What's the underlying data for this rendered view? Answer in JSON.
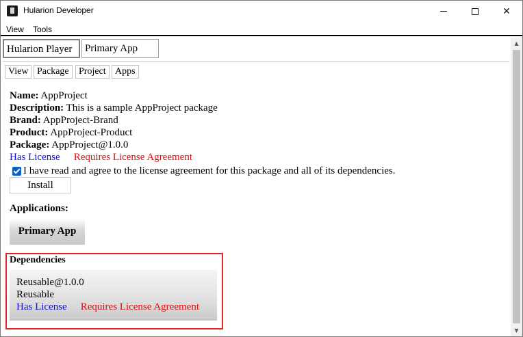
{
  "window": {
    "title": "Hularion Developer",
    "controls": {
      "minimize": "—",
      "maximize": "☐",
      "close": "✕"
    }
  },
  "menu": {
    "view": "View",
    "tools": "Tools"
  },
  "top_tabs": {
    "player": "Hularion Player",
    "primary": "Primary App"
  },
  "sub_tabs": {
    "view": "View",
    "package": "Package",
    "project": "Project",
    "apps": "Apps"
  },
  "package": {
    "name_label": "Name:",
    "name": "AppProject",
    "description_label": "Description:",
    "description": "This is a sample AppProject package",
    "brand_label": "Brand:",
    "brand": "AppProject-Brand",
    "product_label": "Product:",
    "product": "AppProject-Product",
    "package_label": "Package:",
    "package": "AppProject@1.0.0",
    "has_license": "Has License",
    "requires_license": "Requires License Agreement",
    "agree_checked": true,
    "agree_text": "I have read and agree to the license agreement for this package and all of its dependencies.",
    "install_label": "Install"
  },
  "applications": {
    "title": "Applications:",
    "primary_app_label": "Primary App"
  },
  "dependencies": {
    "title": "Dependencies",
    "items": [
      {
        "package": "Reusable@1.0.0",
        "name": "Reusable",
        "has_license": "Has License",
        "requires_license": "Requires License Agreement"
      }
    ]
  },
  "colors": {
    "license_blue": "#1414d2",
    "license_red": "#e00f0f",
    "highlight_outline": "#e3242b",
    "checkbox": "#0a62c9"
  },
  "icons": {
    "app": "hularion-app-icon",
    "scroll_up": "arrow-up-icon",
    "scroll_down": "arrow-down-icon",
    "checkbox": "checkmark-icon"
  }
}
